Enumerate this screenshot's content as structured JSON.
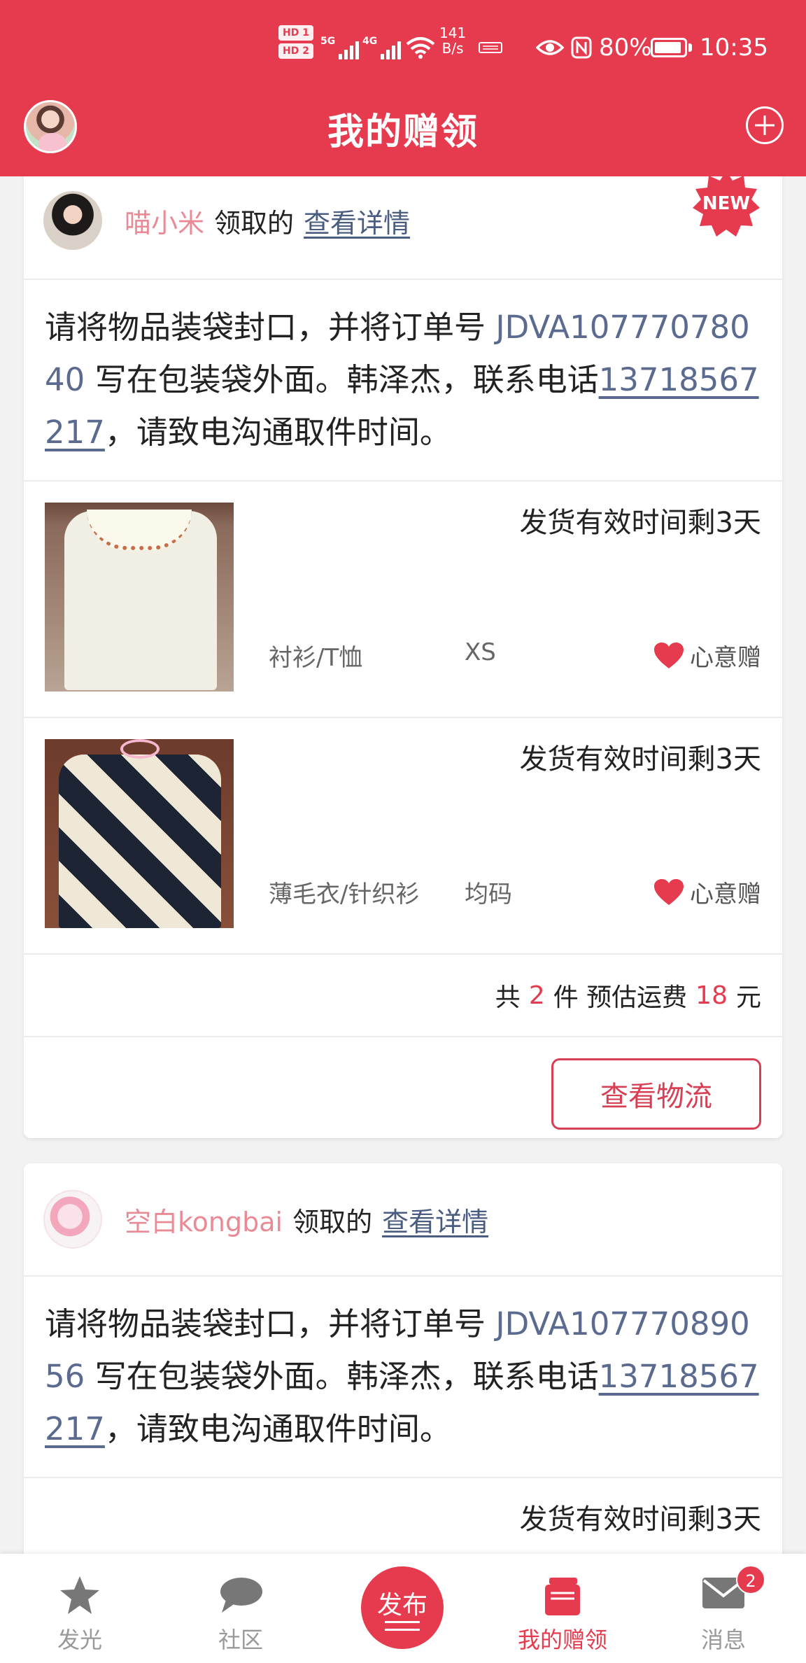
{
  "status_bar": {
    "hd1": "HD 1",
    "hd2": "HD 2",
    "net1": "5G",
    "net2": "4G",
    "speed_value": "141",
    "speed_unit": "B/s",
    "battery": "80%",
    "time": "10:35",
    "icons": [
      "wifi-icon",
      "eye-icon",
      "nfc-icon",
      "battery-icon"
    ]
  },
  "header": {
    "title": "我的赠领"
  },
  "cards": [
    {
      "claimer": "喵小米",
      "claim_suffix": "领取的",
      "detail_link": "查看详情",
      "new_badge": "NEW",
      "instruction_pre": "请将物品装袋封口，并将订单号 ",
      "order_no": "JDVA10777078040",
      "instruction_mid": " 写在包装袋外面。韩泽杰，联系电话",
      "phone": "13718567217",
      "instruction_post": "，请致电沟通取件时间。",
      "items": [
        {
          "expire": "发货有效时间剩3天",
          "category": "衬衫/T恤",
          "size": "XS",
          "gift": "心意赠"
        },
        {
          "expire": "发货有效时间剩3天",
          "category": "薄毛衣/针织衫",
          "size": "均码",
          "gift": "心意赠"
        }
      ],
      "summary": {
        "prefix": "共",
        "count": "2",
        "mid": "件 预估运费",
        "fee": "18",
        "unit": "元"
      },
      "action_label": "查看物流"
    },
    {
      "claimer": "空白kongbai",
      "claim_suffix": "领取的",
      "detail_link": "查看详情",
      "instruction_pre": "请将物品装袋封口，并将订单号 ",
      "order_no": "JDVA10777089056",
      "instruction_mid": " 写在包装袋外面。韩泽杰，联系电话",
      "phone": "13718567217",
      "instruction_post": "，请致电沟通取件时间。",
      "items": [
        {
          "expire": "发货有效时间剩3天"
        }
      ]
    }
  ],
  "bottom_nav": {
    "items": [
      {
        "label": "发光",
        "icon": "star-icon"
      },
      {
        "label": "社区",
        "icon": "chat-bubble-icon"
      },
      {
        "label": "发布",
        "icon": "publish-icon"
      },
      {
        "label": "我的赠领",
        "icon": "gift-box-icon",
        "active": true
      },
      {
        "label": "消息",
        "icon": "mail-icon",
        "badge": "2"
      }
    ]
  },
  "colors": {
    "brand": "#e63b4e",
    "link": "#4a5c80",
    "claimer": "#e98b96"
  }
}
